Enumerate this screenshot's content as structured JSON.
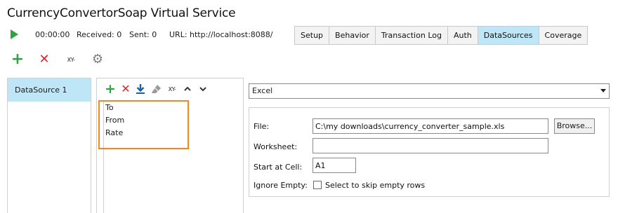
{
  "window": {
    "title": "CurrencyConvertorSoap Virtual Service"
  },
  "status": {
    "play_icon": "play-icon",
    "elapsed": "00:00:00",
    "received": "Received: 0",
    "sent": "Sent: 0",
    "url": "URL: http://localhost:8088/"
  },
  "tabs": [
    {
      "label": "Setup"
    },
    {
      "label": "Behavior"
    },
    {
      "label": "Transaction Log"
    },
    {
      "label": "Auth"
    },
    {
      "label": "DataSources",
      "active": true
    },
    {
      "label": "Coverage"
    }
  ],
  "top_toolbar": {
    "icons": [
      "add-icon",
      "delete-icon",
      "xy-icon",
      "gear-icon"
    ],
    "xy_text": "XY-"
  },
  "datasources": [
    {
      "label": "DataSource 1",
      "selected": true
    }
  ],
  "field_toolbar": {
    "icons": [
      "add-icon",
      "delete-icon",
      "download-icon",
      "eraser-icon",
      "xy-icon",
      "chevron-up-icon",
      "chevron-down-icon"
    ],
    "xy_text": "XY-"
  },
  "fields": [
    "To",
    "From",
    "Rate"
  ],
  "source_type": {
    "selected": "Excel"
  },
  "config": {
    "file_label": "File:",
    "file_value": "C:\\my downloads\\currency_converter_sample.xls",
    "browse_label": "Browse...",
    "worksheet_label": "Worksheet:",
    "worksheet_value": "",
    "start_cell_label": "Start at Cell:",
    "start_cell_value": "A1",
    "ignore_empty_label": "Ignore Empty:",
    "ignore_empty_checkbox_label": "Select to skip empty rows",
    "ignore_empty_checked": false
  },
  "colors": {
    "accent_tab": "#bfe6f7",
    "highlight": "#f28a1a",
    "green": "#2ea33e",
    "red": "#d9262c"
  }
}
